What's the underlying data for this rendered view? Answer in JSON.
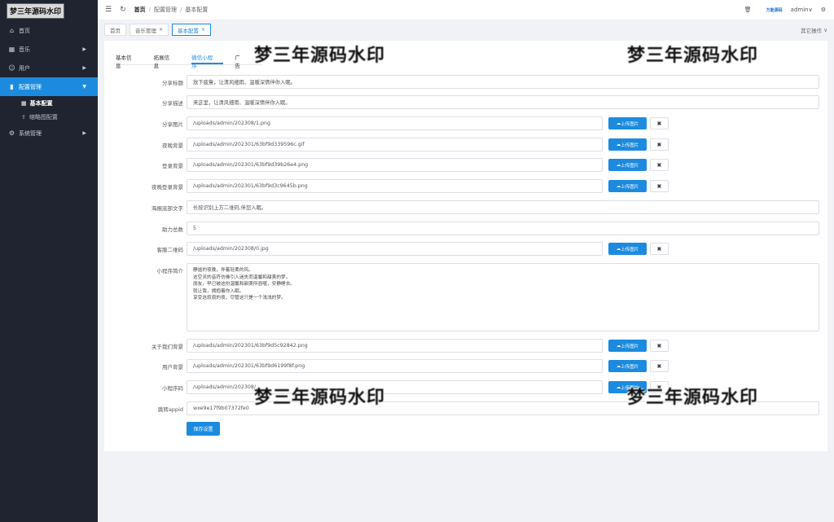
{
  "logo": "梦三年源码水印",
  "sidebar": {
    "items": [
      {
        "label": "首页"
      },
      {
        "label": "音乐"
      },
      {
        "label": "用户"
      },
      {
        "label": "配置管理"
      },
      {
        "label": "系统管理"
      }
    ],
    "sub": [
      {
        "label": "基本配置"
      },
      {
        "label": "缩略图配置"
      }
    ]
  },
  "breadcrumb": {
    "home": "首页",
    "section": "配置管理",
    "page": "基本配置"
  },
  "header": {
    "brand": "万能源码",
    "user": "admin"
  },
  "tabs": {
    "items": [
      {
        "label": "首页"
      },
      {
        "label": "音乐管理"
      },
      {
        "label": "基本配置"
      }
    ],
    "other_ops": "其它操作"
  },
  "subtabs": [
    {
      "label": "基本信息"
    },
    {
      "label": "拓展信息"
    },
    {
      "label": "微信小程序"
    },
    {
      "label": "广告"
    }
  ],
  "form": {
    "upload_label": "上传图片",
    "save_label": "保存设置",
    "fields": [
      {
        "label": "分享标题",
        "value": "放下疲惫，让清风细雨、温暖深情伴你入眠。"
      },
      {
        "label": "分享描述",
        "value": "来这里，让清风细雨、温暖深情伴你入眠。"
      },
      {
        "label": "分享图片",
        "value": "/uploads/admin/202308/1.png"
      },
      {
        "label": "夜晚背景",
        "value": "/uploads/admin/202301/63bf9d339596c.gif"
      },
      {
        "label": "登录背景",
        "value": "/uploads/admin/202301/63bf9d39b26e4.png"
      },
      {
        "label": "夜晚登录背景",
        "value": "/uploads/admin/202301/63bf9d3c9645b.png"
      },
      {
        "label": "海报底部文字",
        "value": "长按识别上方二维码,伴您入眠。"
      },
      {
        "label": "助力总数",
        "value": "5"
      },
      {
        "label": "客服二维码",
        "value": "/uploads/admin/202308/0.jpg"
      },
      {
        "label": "小程序简介",
        "lines": [
          "静谧的夜晚，伴着轻柔的风。",
          "这空灵的音符仿佛引入迷失而温馨和甜美的梦。",
          "朋友，早已被这份温馨和甜美所吞噬，安静睡去。",
          "就让我，拥抱着你入眠。",
          "享受这寂寂的夜，尽管这只是一个浅浅的梦。"
        ]
      },
      {
        "label": "关于我们背景",
        "value": "/uploads/admin/202301/63bf9d5c92842.png"
      },
      {
        "label": "用户背景",
        "value": "/uploads/admin/202301/63bf9d6199f8f.png"
      },
      {
        "label": "小程序码",
        "value": "/uploads/admin/202308/"
      },
      {
        "label": "跳转appid",
        "value": "wxe9e17f9b07372fe0"
      }
    ]
  },
  "watermark": "梦三年源码水印"
}
